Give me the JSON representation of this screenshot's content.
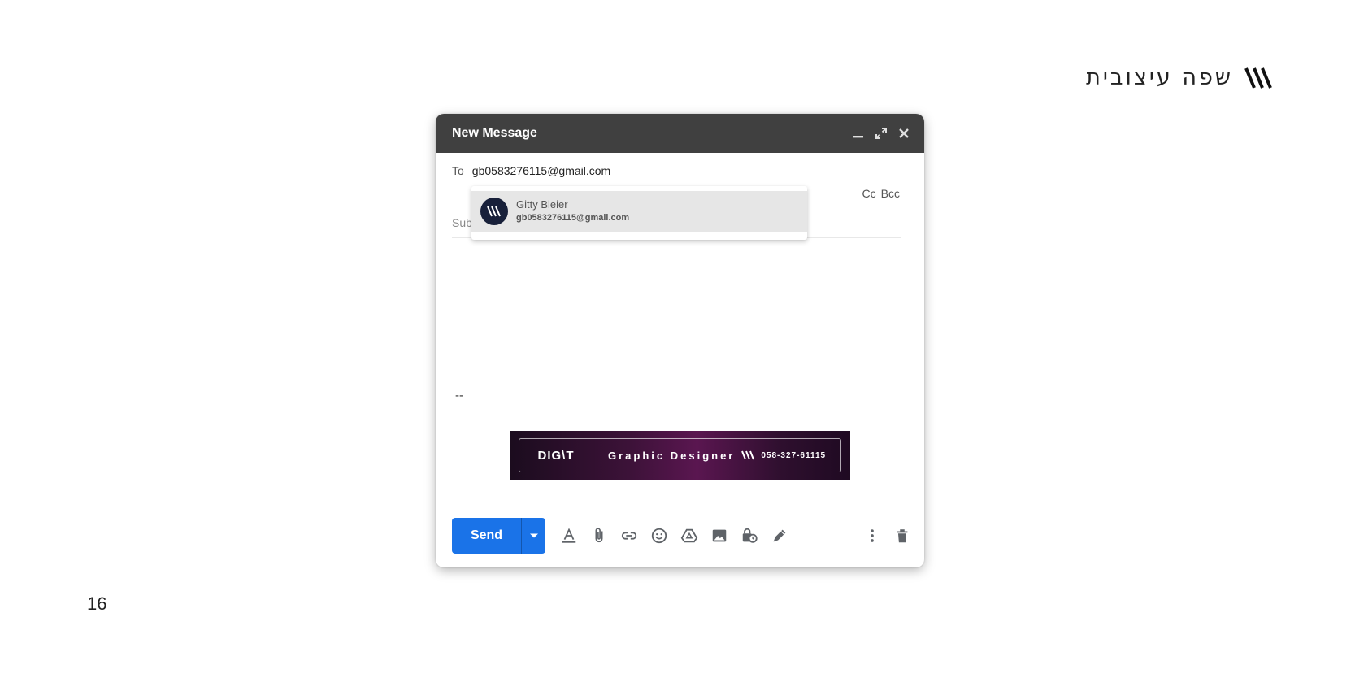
{
  "page": {
    "title": "שפה עיצובית",
    "brand_icon": "triple-slash-logo-icon",
    "page_number": "16"
  },
  "compose": {
    "title": "New Message",
    "header_icons": [
      "minimize-icon",
      "expand-icon",
      "close-icon"
    ],
    "to_label": "To",
    "to_value": "gb0583276115@gmail.com",
    "cc_label": "Cc",
    "bcc_label": "Bcc",
    "subject_placeholder": "Sub",
    "signature_separator": "--",
    "suggestion": {
      "name": "Gitty Bleier",
      "email": "gb0583276115@gmail.com"
    },
    "signature_banner": {
      "logo_text": "DIG\\T",
      "role": "Graphic Designer",
      "phone": "058-327-61115"
    },
    "toolbar": {
      "send_label": "Send",
      "tools": [
        "formatting-icon",
        "attach-icon",
        "link-icon",
        "emoji-icon",
        "drive-icon",
        "photo-icon",
        "confidential-icon",
        "signature-icon"
      ],
      "right_icons": [
        "more-options-icon",
        "trash-icon"
      ]
    }
  },
  "colors": {
    "header_bg": "#404040",
    "send_blue": "#1a73e8",
    "avatar_bg": "#18203a",
    "banner_purple": "#5a1650"
  }
}
